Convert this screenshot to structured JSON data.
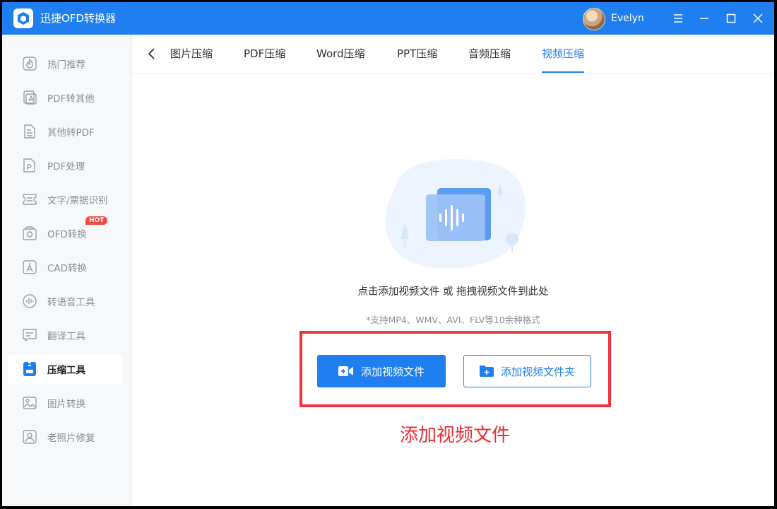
{
  "app": {
    "title": "迅捷OFD转换器",
    "brand_color": "#1f7ff0"
  },
  "user": {
    "name": "Evelyn"
  },
  "window_controls": [
    "menu-icon",
    "minimize-icon",
    "maximize-icon",
    "close-icon"
  ],
  "sidebar": {
    "items": [
      {
        "label": "热门推荐",
        "icon": "hot-recommend-icon"
      },
      {
        "label": "PDF转其他",
        "icon": "pdf-convert-icon"
      },
      {
        "label": "其他转PDF",
        "icon": "to-pdf-icon"
      },
      {
        "label": "PDF处理",
        "icon": "pdf-process-icon"
      },
      {
        "label": "文字/票据识别",
        "icon": "ocr-icon"
      },
      {
        "label": "OFD转换",
        "icon": "ofd-icon",
        "badge": "HOT"
      },
      {
        "label": "CAD转换",
        "icon": "cad-icon"
      },
      {
        "label": "转语音工具",
        "icon": "voice-icon"
      },
      {
        "label": "翻译工具",
        "icon": "translate-icon"
      },
      {
        "label": "压缩工具",
        "icon": "compress-icon",
        "active": true
      },
      {
        "label": "图片转换",
        "icon": "image-convert-icon"
      },
      {
        "label": "老照片修复",
        "icon": "photo-repair-icon"
      }
    ]
  },
  "tabs": [
    {
      "label": "图片压缩"
    },
    {
      "label": "PDF压缩"
    },
    {
      "label": "Word压缩"
    },
    {
      "label": "PPT压缩"
    },
    {
      "label": "音频压缩"
    },
    {
      "label": "视频压缩",
      "active": true
    }
  ],
  "main": {
    "hint": "点击添加视频文件 或 拖拽视频文件到此处",
    "formats": "*支持MP4、WMV、AVI、FLV等10余种格式",
    "add_file_button": "添加视频文件",
    "add_folder_button": "添加视频文件夹",
    "annotation": "添加视频文件",
    "annotation_color": "#ef2b34"
  }
}
